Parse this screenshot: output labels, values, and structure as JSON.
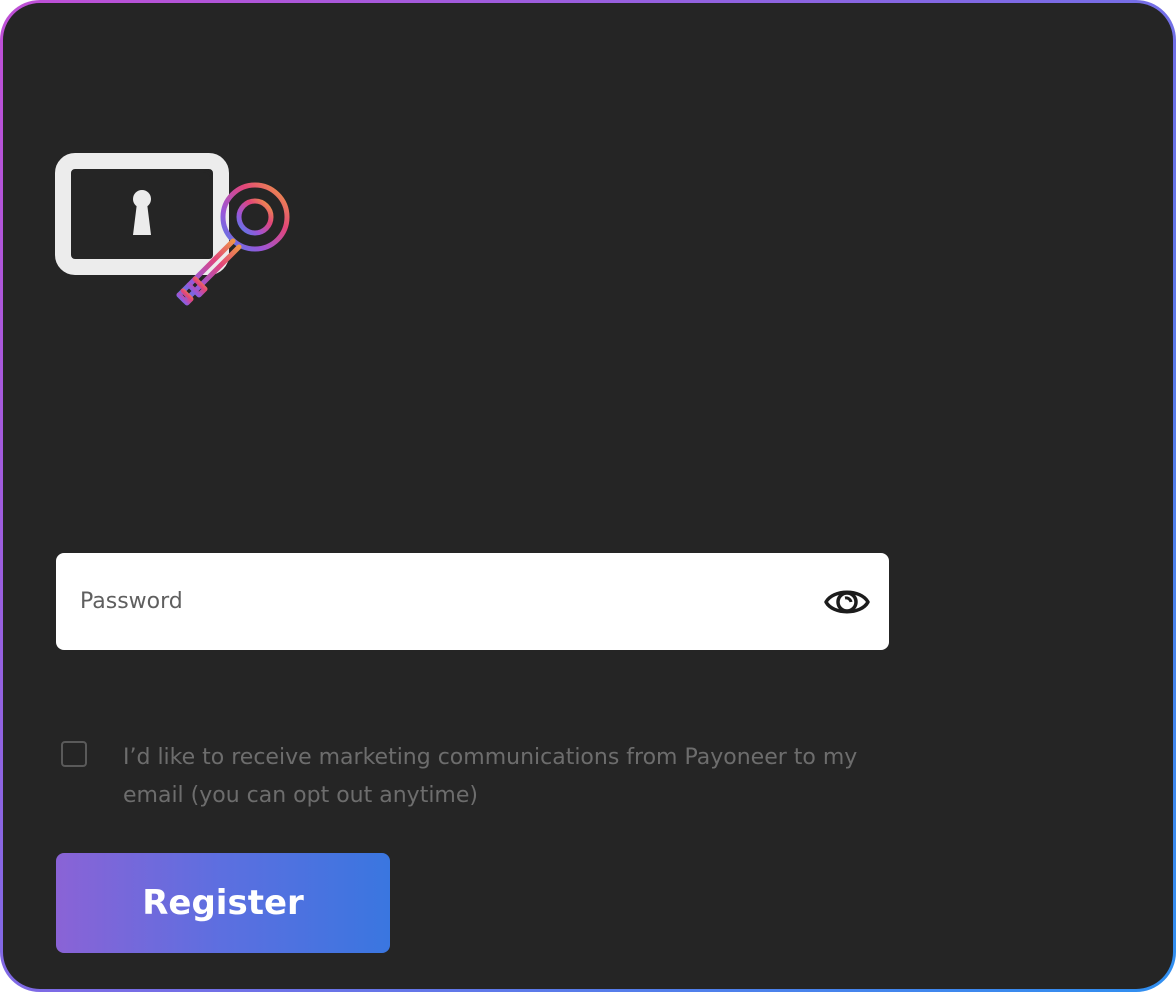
{
  "password_field": {
    "placeholder": "Password",
    "value": "",
    "toggle_icon": "eye-icon"
  },
  "consent": {
    "checked": false,
    "text": "I’d like to receive marketing communications from Payoneer to my email (you can opt out anytime)"
  },
  "register_button": {
    "label": "Register"
  },
  "illustration": {
    "icon": "lock-and-key-icon"
  },
  "colors": {
    "panel_background": "#252525",
    "border_gradient_start": "#c04fd6",
    "border_gradient_end": "#2f8ff0",
    "button_gradient_start": "#8a63d6",
    "button_gradient_end": "#3a76e0"
  }
}
